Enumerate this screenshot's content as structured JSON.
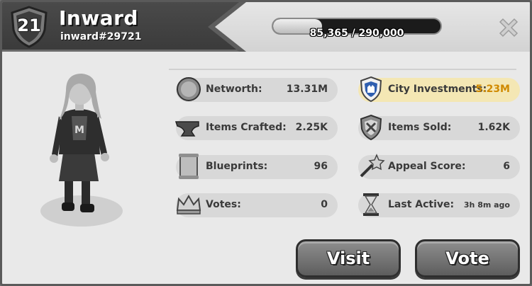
{
  "header": {
    "level": "21",
    "name": "Inward",
    "player_id": "inward#29721",
    "progress": {
      "text": "85,365 / 290,000",
      "current": 85365,
      "max": 290000
    }
  },
  "stats_left": [
    {
      "label": "Networth:",
      "value": "13.31M",
      "icon": "coin-icon"
    },
    {
      "label": "Items Crafted:",
      "value": "2.25K",
      "icon": "anvil-icon"
    },
    {
      "label": "Blueprints:",
      "value": "96",
      "icon": "scroll-icon"
    },
    {
      "label": "Votes:",
      "value": "0",
      "icon": "crown-icon"
    }
  ],
  "stats_right": [
    {
      "label": "City Investments:",
      "value": "5.23M",
      "icon": "city-shield-icon",
      "highlight": true
    },
    {
      "label": "Items Sold:",
      "value": "1.62K",
      "icon": "items-sold-shield-icon"
    },
    {
      "label": "Appeal Score:",
      "value": "6",
      "icon": "star-wand-icon"
    },
    {
      "label": "Last Active:",
      "value": "3h 8m ago",
      "icon": "hourglass-icon"
    }
  ],
  "buttons": {
    "visit": "Visit",
    "vote": "Vote"
  },
  "colors": {
    "highlight_bg": "#f4e7b4",
    "highlight_value": "#d08a00"
  }
}
